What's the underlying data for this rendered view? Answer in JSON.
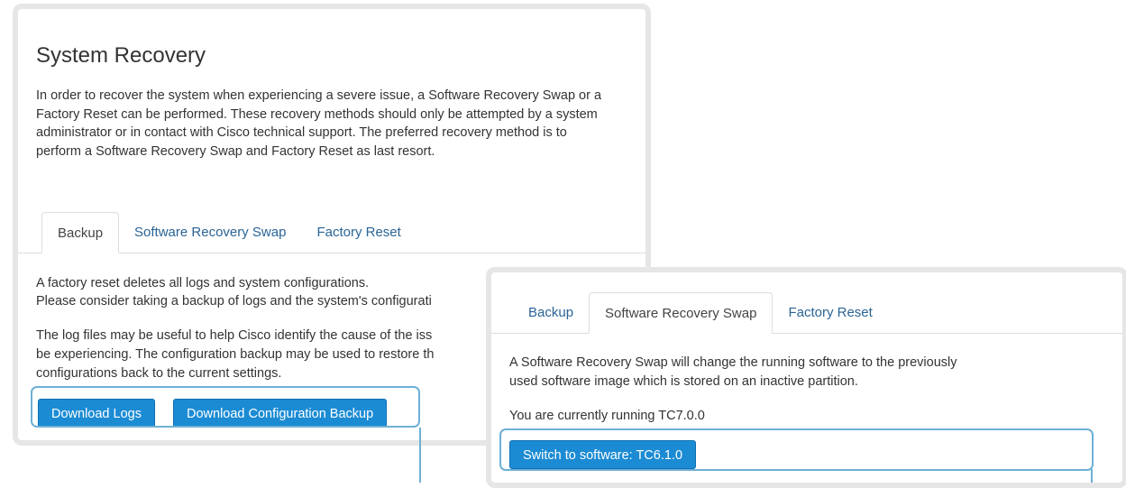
{
  "main": {
    "title": "System Recovery",
    "intro": "In order to recover the system when experiencing a severe issue, a Software Recovery Swap or a Factory Reset can be performed. These recovery methods should only be attempted by a system administrator or in contact with Cisco technical support. The preferred recovery method is to perform a Software Recovery Swap and Factory Reset as last resort.",
    "tabs": [
      {
        "label": "Backup",
        "active": true
      },
      {
        "label": "Software Recovery Swap",
        "active": false
      },
      {
        "label": "Factory Reset",
        "active": false
      }
    ],
    "backup": {
      "line1": "A factory reset deletes all logs and system configurations.",
      "line2": "Please consider taking a backup of logs and the system's configurati",
      "line3": "The log files may be useful to help Cisco identify the cause of the iss",
      "line4": " be experiencing. The configuration backup may be used to restore th",
      "line5": "configurations back to the current settings.",
      "download_logs": "Download Logs",
      "download_config": "Download Configuration Backup"
    }
  },
  "swap": {
    "tabs": [
      {
        "label": "Backup",
        "active": false
      },
      {
        "label": "Software Recovery Swap",
        "active": true
      },
      {
        "label": "Factory Reset",
        "active": false
      }
    ],
    "line1": "A Software Recovery Swap will change the running software to the previously",
    "line2": "used software image which is stored on an inactive partition.",
    "current": "You are currently running TC7.0.0",
    "switch_button": "Switch to software: TC6.1.0"
  },
  "colors": {
    "button": "#1b8bd4",
    "link": "#2a6496",
    "callout": "#6db0d6"
  }
}
